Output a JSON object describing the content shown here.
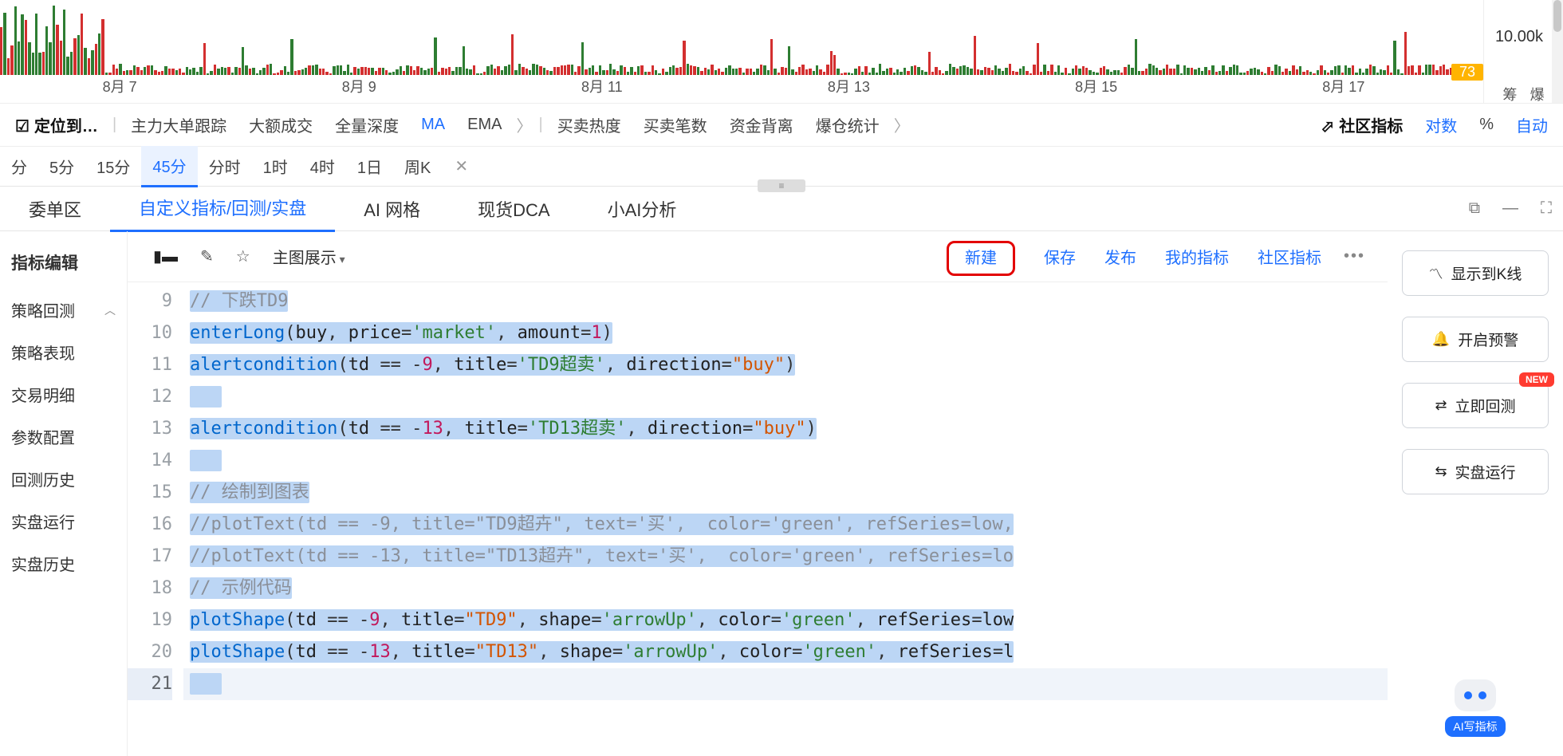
{
  "chart": {
    "y_label": "10.00k",
    "badge": "73",
    "x_ticks": [
      "8月 7",
      "8月 9",
      "8月 11",
      "8月 13",
      "8月 15",
      "8月 17"
    ],
    "side_labels": [
      "筹",
      "爆"
    ]
  },
  "indicator_bar": {
    "locate": "定位到…",
    "items_left": [
      "主力大单跟踪",
      "大额成交",
      "全量深度"
    ],
    "ma": "MA",
    "ema": "EMA",
    "items_mid": [
      "买卖热度",
      "买卖笔数",
      "资金背离",
      "爆仓统计"
    ],
    "community": "社区指标",
    "log": "对数",
    "percent": "%",
    "auto": "自动"
  },
  "timeframes": {
    "items": [
      "分",
      "5分",
      "15分",
      "45分",
      "分时",
      "1时",
      "4时",
      "1日",
      "周K"
    ],
    "active_index": 3
  },
  "main_tabs": {
    "items": [
      "委单区",
      "自定义指标/回测/实盘",
      "AI 网格",
      "现货DCA",
      "小AI分析"
    ],
    "active_index": 1
  },
  "left_nav": {
    "heading": "指标编辑",
    "items": [
      "策略回测",
      "策略表现",
      "交易明细",
      "参数配置",
      "回测历史",
      "实盘运行",
      "实盘历史"
    ],
    "expandable_index": 0
  },
  "editor_toolbar": {
    "display_dropdown": "主图展示",
    "links": {
      "new": "新建",
      "save": "保存",
      "publish": "发布",
      "my_indicators": "我的指标",
      "community_indicators": "社区指标"
    }
  },
  "code": {
    "start_line": 9,
    "lines_raw": [
      "// 下跌TD9",
      "enterLong(buy, price='market', amount=1)",
      "alertcondition(td == -9, title='TD9超卖', direction=\"buy\")",
      "",
      "alertcondition(td == -13, title='TD13超卖', direction=\"buy\")",
      "",
      "// 绘制到图表",
      "//plotText(td == -9, title=\"TD9超卉\", text='买',  color='green', refSeries=low,",
      "//plotText(td == -13, title=\"TD13超卉\", text='买',  color='green', refSeries=lo",
      "// 示例代码",
      "plotShape(td == -9, title=\"TD9\", shape='arrowUp', color='green', refSeries=low",
      "plotShape(td == -13, title=\"TD13\", shape='arrowUp', color='green', refSeries=l",
      ""
    ],
    "current_line": 21
  },
  "right_actions": {
    "show_k": "显示到K线",
    "alert": "开启预警",
    "backtest": "立即回测",
    "live": "实盘运行",
    "badge_new": "NEW",
    "ai_label": "AI写指标"
  }
}
